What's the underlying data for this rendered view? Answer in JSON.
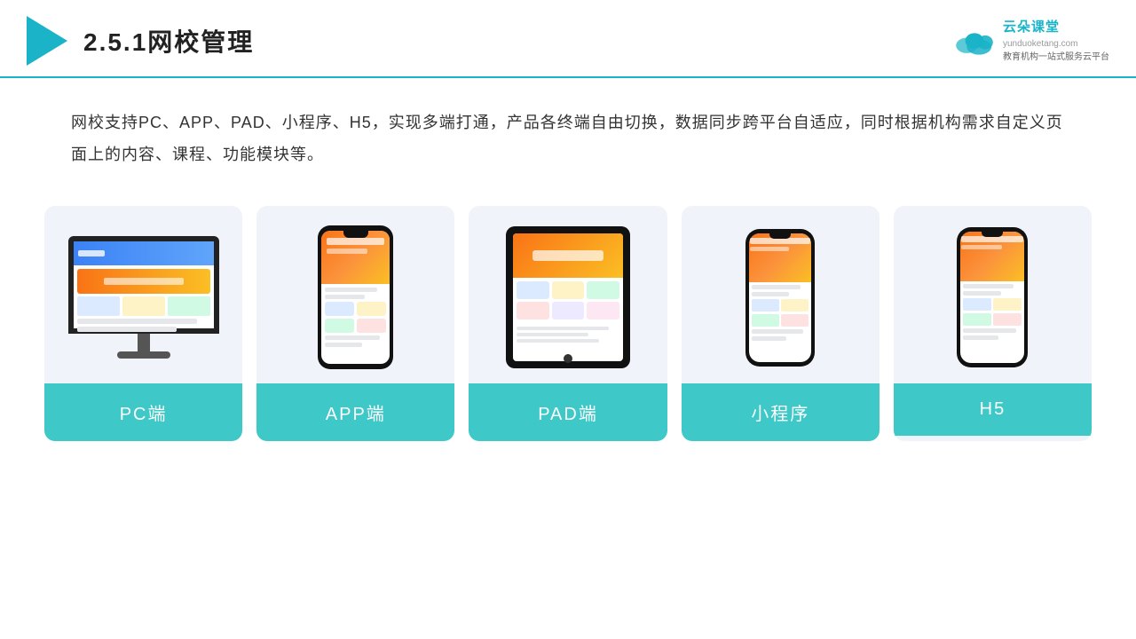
{
  "header": {
    "title": "2.5.1网校管理",
    "logo": {
      "brand": "云朵课堂",
      "subtitle_line1": "教育机构一站",
      "subtitle_line2": "式服务云平台",
      "domain": "yunduoketang.com"
    }
  },
  "description": {
    "text": "网校支持PC、APP、PAD、小程序、H5，实现多端打通，产品各终端自由切换，数据同步跨平台自适应，同时根据机构需求自定义页面上的内容、课程、功能模块等。"
  },
  "cards": [
    {
      "id": "pc",
      "label": "PC端"
    },
    {
      "id": "app",
      "label": "APP端"
    },
    {
      "id": "pad",
      "label": "PAD端"
    },
    {
      "id": "miniapp",
      "label": "小程序"
    },
    {
      "id": "h5",
      "label": "H5"
    }
  ],
  "colors": {
    "accent": "#1ab3c8",
    "card_bg": "#edf2fb",
    "card_label_bg": "#3ec8c8",
    "orange": "#f97316",
    "yellow": "#fbbf24"
  }
}
